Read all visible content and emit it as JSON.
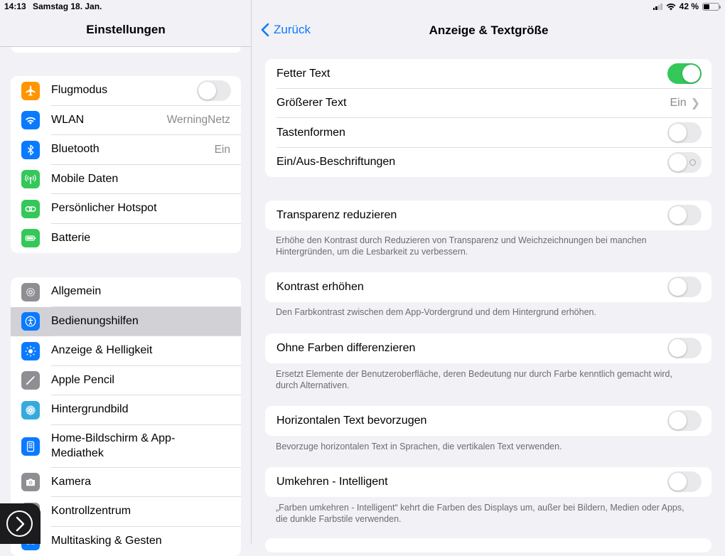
{
  "status": {
    "time": "14:13",
    "date": "Samstag 18. Jan.",
    "battery": "42 %"
  },
  "sidebar": {
    "title": "Einstellungen",
    "group1": [
      {
        "label": "Flugmodus",
        "icon": "airplane-icon",
        "color": "#ff9500",
        "toggle": false
      },
      {
        "label": "WLAN",
        "icon": "wifi-icon",
        "color": "#0a7aff",
        "value": "WerningNetz"
      },
      {
        "label": "Bluetooth",
        "icon": "bluetooth-icon",
        "color": "#0a7aff",
        "value": "Ein"
      },
      {
        "label": "Mobile Daten",
        "icon": "antenna-icon",
        "color": "#34c759"
      },
      {
        "label": "Persönlicher Hotspot",
        "icon": "link-icon",
        "color": "#34c759"
      },
      {
        "label": "Batterie",
        "icon": "battery-icon",
        "color": "#34c759"
      }
    ],
    "group2": [
      {
        "label": "Allgemein",
        "icon": "gear-icon",
        "color": "#8e8e93"
      },
      {
        "label": "Bedienungshilfen",
        "icon": "accessibility-icon",
        "color": "#0a7aff",
        "selected": true
      },
      {
        "label": "Anzeige & Helligkeit",
        "icon": "sun-icon",
        "color": "#0a7aff"
      },
      {
        "label": "Apple Pencil",
        "icon": "pencil-icon",
        "color": "#8e8e93"
      },
      {
        "label": "Hintergrundbild",
        "icon": "flower-icon",
        "color": "#35aadc"
      },
      {
        "label": "Home-Bildschirm & App-Mediathek",
        "icon": "grid-icon",
        "color": "#0a7aff"
      },
      {
        "label": "Kamera",
        "icon": "camera-icon",
        "color": "#8e8e93"
      },
      {
        "label": "Kontrollzentrum",
        "icon": "switches-icon",
        "color": "#8e8e93"
      },
      {
        "label": "Multitasking & Gesten",
        "icon": "multitask-icon",
        "color": "#0a7aff"
      }
    ]
  },
  "detail": {
    "back": "Zurück",
    "title": "Anzeige & Textgröße",
    "top_group": [
      {
        "label": "Fetter Text",
        "toggle": true
      },
      {
        "label": "Größerer Text",
        "value": "Ein"
      },
      {
        "label": "Tastenformen",
        "toggle": false
      },
      {
        "label": "Ein/Aus-Beschriftungen",
        "toggle": false
      }
    ],
    "items": [
      {
        "label": "Transparenz reduzieren",
        "note": "Erhöhe den Kontrast durch Reduzieren von Transparenz und Weichzeichnungen bei manchen Hintergründen, um die Lesbarkeit zu verbessern."
      },
      {
        "label": "Kontrast erhöhen",
        "note": "Den Farbkontrast zwischen dem App-Vordergrund und dem Hintergrund erhöhen."
      },
      {
        "label": "Ohne Farben differenzieren",
        "note": "Ersetzt Elemente der Benutzeroberfläche, deren Bedeutung nur durch Farbe kenntlich gemacht wird, durch Alternativen."
      },
      {
        "label": "Horizontalen Text bevorzugen",
        "note": "Bevorzuge horizontalen Text in Sprachen, die vertikalen Text verwenden."
      },
      {
        "label": "Umkehren - Intelligent",
        "note": "„Farben umkehren - Intelligent“ kehrt die Farben des Displays um, außer bei Bildern, Medien oder Apps, die dunkle Farbstile verwenden."
      }
    ]
  },
  "colors": {
    "accent": "#0a7aff",
    "toggle_on": "#34c759",
    "selected_row": "#d1d1d6"
  }
}
